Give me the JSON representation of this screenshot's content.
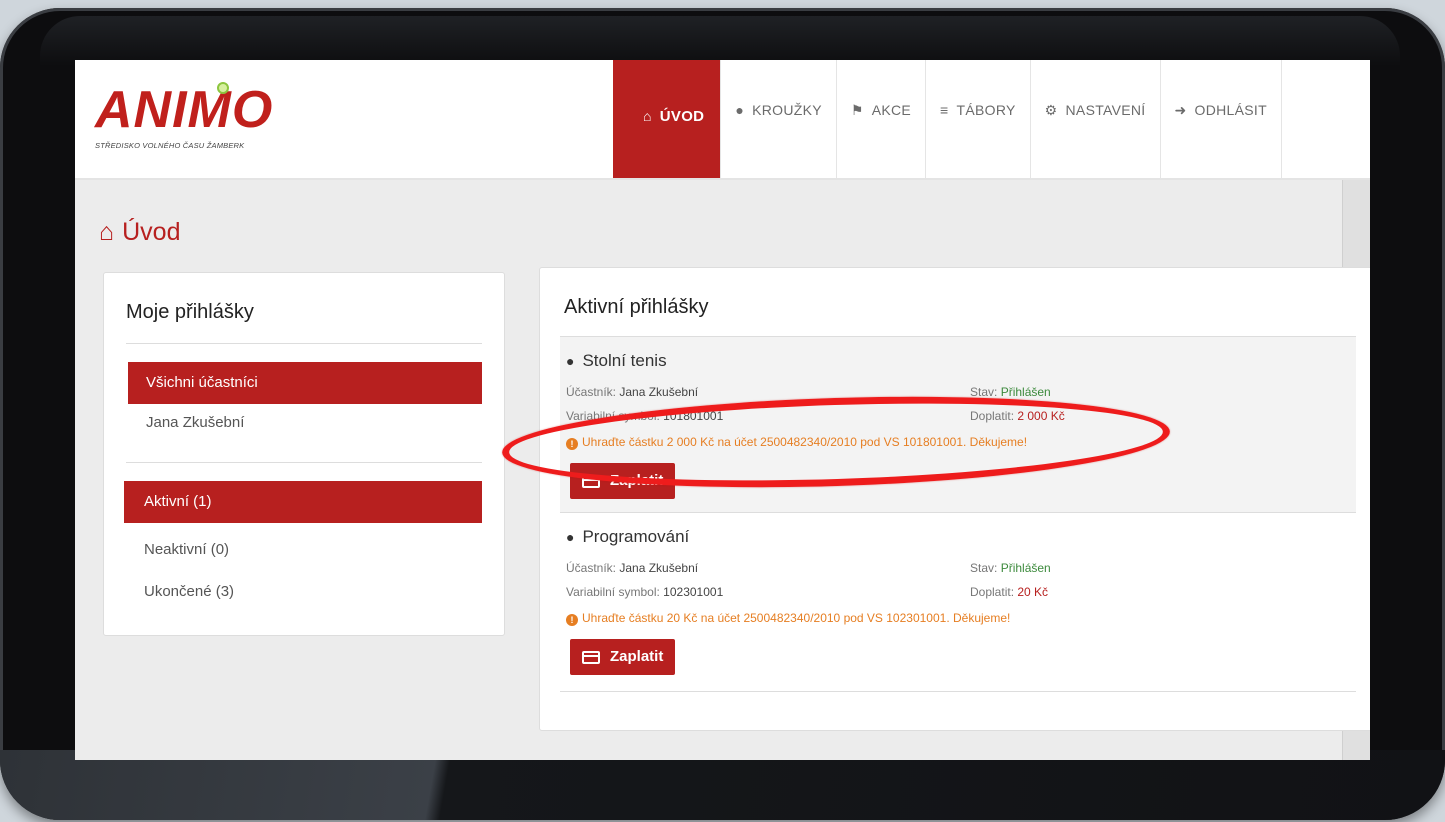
{
  "logo": {
    "title": "ANIMO",
    "subtitle": "STŘEDISKO VOLNÉHO ČASU ŽAMBERK"
  },
  "nav": [
    {
      "label": "ÚVOD",
      "icon": "home-icon",
      "active": true
    },
    {
      "label": "KROUŽKY",
      "icon": "lightbulb-icon",
      "active": false
    },
    {
      "label": "AKCE",
      "icon": "trophy-icon",
      "active": false
    },
    {
      "label": "TÁBORY",
      "icon": "signpost-icon",
      "active": false
    },
    {
      "label": "NASTAVENÍ",
      "icon": "gear-icon",
      "active": false
    },
    {
      "label": "ODHLÁSIT",
      "icon": "logout-icon",
      "active": false
    }
  ],
  "page": {
    "title": "Úvod"
  },
  "left_panel": {
    "title": "Moje přihlášky",
    "participants": {
      "all_label": "Všichni účastníci",
      "items": [
        "Jana Zkušební"
      ]
    },
    "filters": {
      "active_label": "Aktivní (1)",
      "inactive_label": "Neaktivní (0)",
      "ended_label": "Ukončené (3)"
    }
  },
  "right_panel": {
    "title": "Aktivní přihlášky",
    "courses": [
      {
        "name": "Stolní tenis",
        "participant_label": "Účastník:",
        "participant": "Jana Zkušební",
        "state_label": "Stav:",
        "state": "Přihlášen",
        "vs_label": "Variabilní symbol:",
        "vs": "101801001",
        "due_label": "Doplatit:",
        "due": "2 000 Kč",
        "warning": "Uhraďte částku 2 000 Kč na účet 2500482340/2010 pod VS 101801001. Děkujeme!",
        "pay_label": "Zaplatit"
      },
      {
        "name": "Programování",
        "participant_label": "Účastník:",
        "participant": "Jana Zkušební",
        "state_label": "Stav:",
        "state": "Přihlášen",
        "vs_label": "Variabilní symbol:",
        "vs": "102301001",
        "due_label": "Doplatit:",
        "due": "20 Kč",
        "warning": "Uhraďte částku 20 Kč na účet 2500482340/2010 pod VS 102301001. Děkujeme!",
        "pay_label": "Zaplatit"
      }
    ]
  },
  "colors": {
    "brand": "#b7201f",
    "warning": "#e67e22",
    "success": "#3c8a3c",
    "annotation": "#ee1c1c"
  }
}
